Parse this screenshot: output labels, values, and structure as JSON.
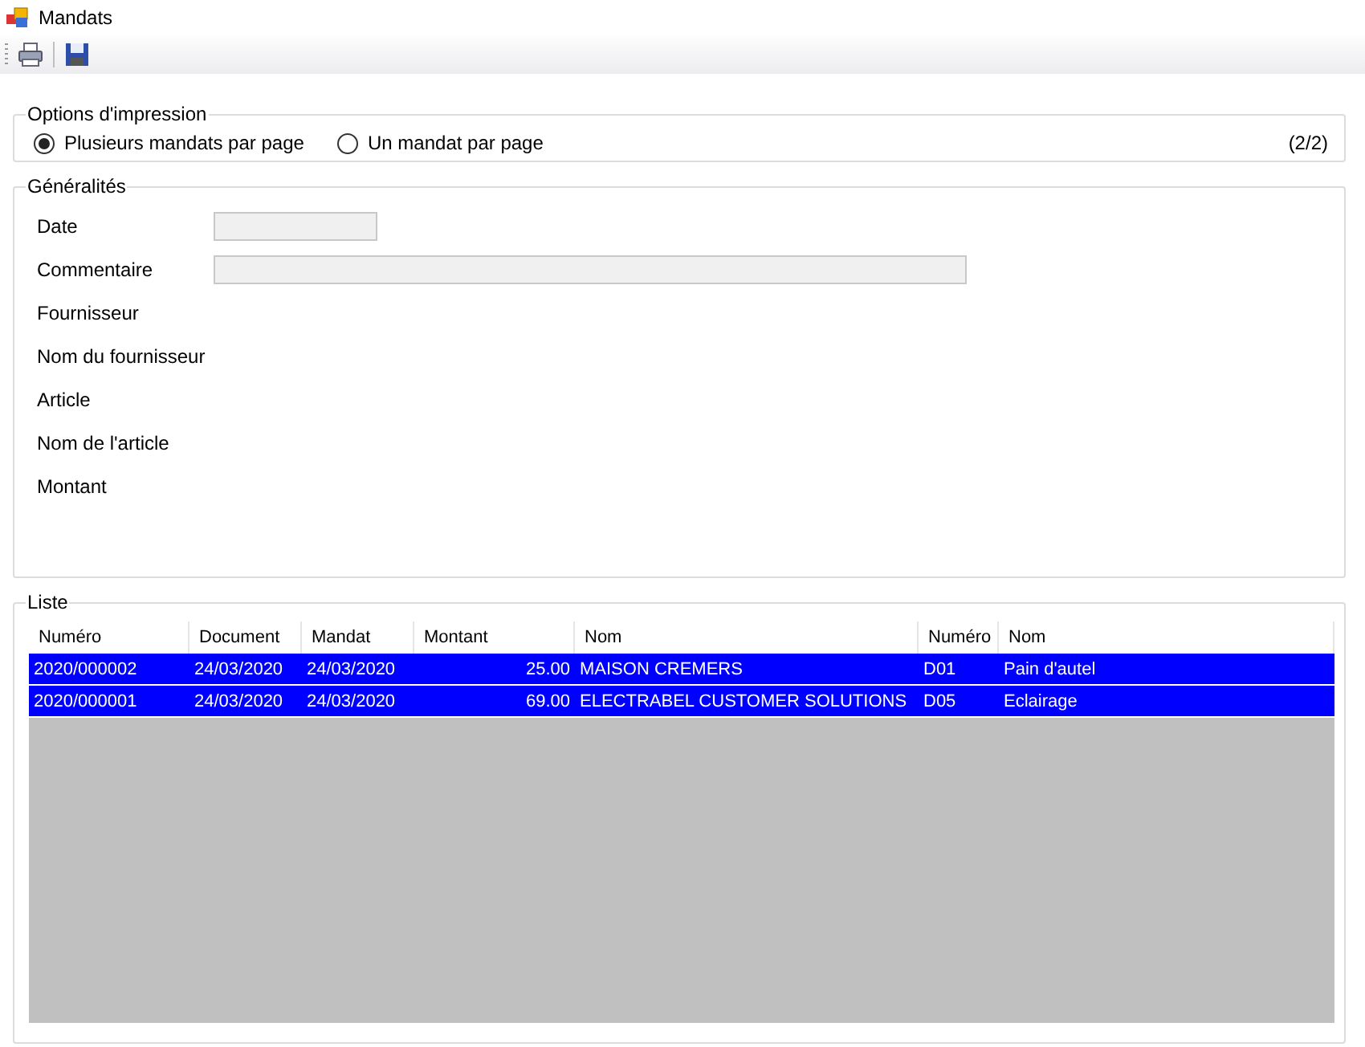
{
  "window": {
    "title": "Mandats"
  },
  "print_options": {
    "title": "Options d'impression",
    "options": [
      {
        "label": "Plusieurs mandats par page",
        "selected": true
      },
      {
        "label": "Un mandat par page",
        "selected": false
      }
    ],
    "page_counter": "(2/2)"
  },
  "general": {
    "title": "Généralités",
    "fields": [
      {
        "label": "Date",
        "kind": "short"
      },
      {
        "label": "Commentaire",
        "kind": "wide"
      },
      {
        "label": "Fournisseur",
        "kind": "none"
      },
      {
        "label": "Nom du fournisseur",
        "kind": "none"
      },
      {
        "label": "Article",
        "kind": "none"
      },
      {
        "label": "Nom de l'article",
        "kind": "none"
      },
      {
        "label": "Montant",
        "kind": "none"
      }
    ]
  },
  "list": {
    "title": "Liste",
    "columns": [
      "Numéro",
      "Document",
      "Mandat",
      "Montant",
      "Nom",
      "Numéro",
      "Nom"
    ],
    "rows": [
      {
        "cells": [
          "2020/000002",
          "24/03/2020",
          "24/03/2020",
          "25.00",
          "MAISON CREMERS",
          "D01",
          "Pain d'autel"
        ],
        "selected": true
      },
      {
        "cells": [
          "2020/000001",
          "24/03/2020",
          "24/03/2020",
          "69.00",
          "ELECTRABEL CUSTOMER SOLUTIONS",
          "D05",
          "Eclairage"
        ],
        "selected": true
      }
    ]
  }
}
